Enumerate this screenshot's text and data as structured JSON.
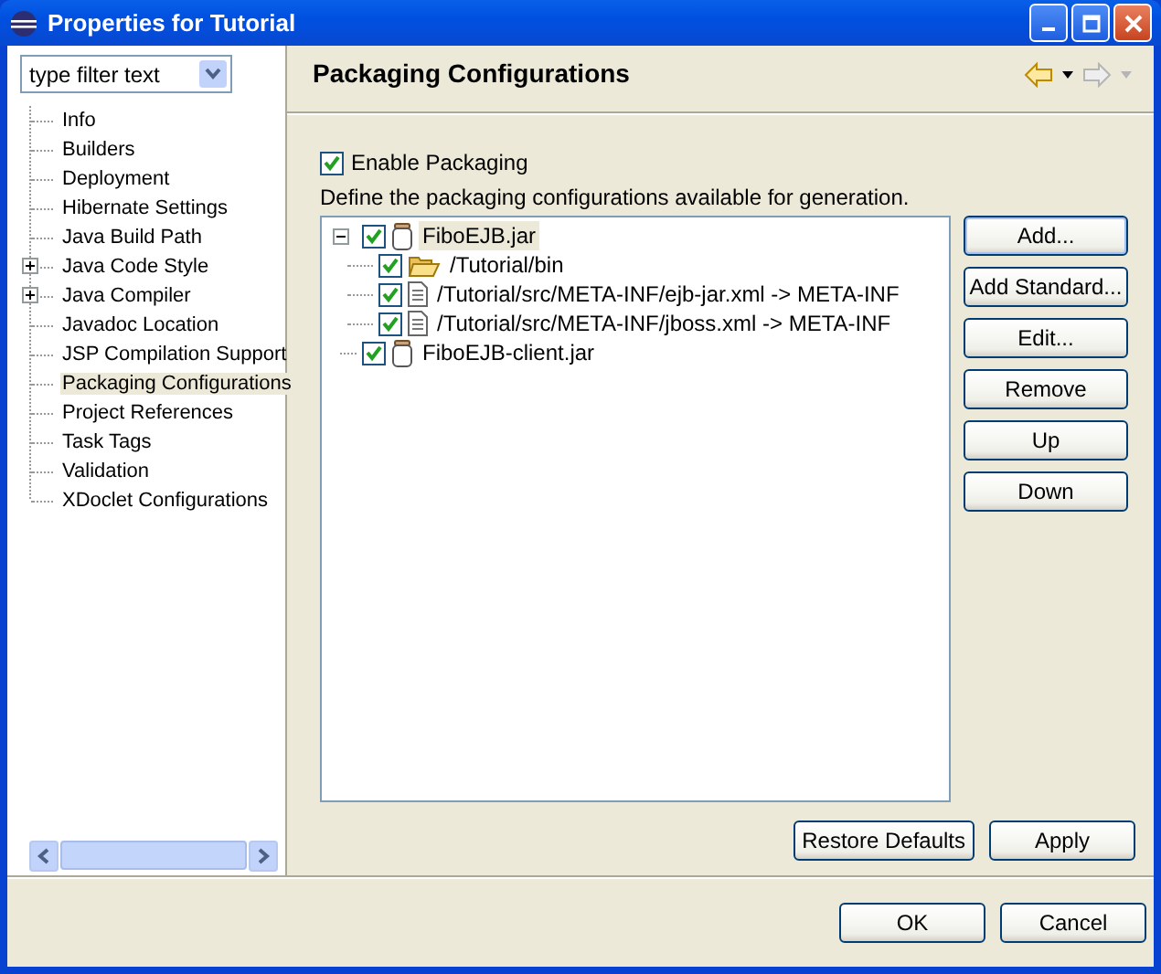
{
  "window": {
    "title": "Properties for Tutorial"
  },
  "filter": {
    "placeholder": "type filter text"
  },
  "sidebar": {
    "items": [
      {
        "label": "Info",
        "selected": false
      },
      {
        "label": "Builders",
        "selected": false
      },
      {
        "label": "Deployment",
        "selected": false
      },
      {
        "label": "Hibernate Settings",
        "selected": false
      },
      {
        "label": "Java Build Path",
        "selected": false
      },
      {
        "label": "Java Code Style",
        "selected": false,
        "expanded": false
      },
      {
        "label": "Java Compiler",
        "selected": false,
        "expanded": false
      },
      {
        "label": "Javadoc Location",
        "selected": false
      },
      {
        "label": "JSP Compilation Support",
        "selected": false
      },
      {
        "label": "Packaging Configurations",
        "selected": true
      },
      {
        "label": "Project References",
        "selected": false
      },
      {
        "label": "Task Tags",
        "selected": false
      },
      {
        "label": "Validation",
        "selected": false
      },
      {
        "label": "XDoclet Configurations",
        "selected": false
      }
    ]
  },
  "page": {
    "title": "Packaging Configurations",
    "nav": {
      "back_disabled": false,
      "forward_disabled": true
    },
    "enable_packaging": {
      "label": "Enable Packaging",
      "checked": true
    },
    "description": "Define the packaging configurations available for generation.",
    "tree": [
      {
        "label": "FiboEJB.jar",
        "kind": "jar",
        "checked": true,
        "selected": true,
        "expanded": true,
        "children": [
          {
            "label": "/Tutorial/bin",
            "kind": "folder",
            "checked": true,
            "selected": false
          },
          {
            "label": "/Tutorial/src/META-INF/ejb-jar.xml -> META-INF",
            "kind": "file",
            "checked": true,
            "selected": false
          },
          {
            "label": "/Tutorial/src/META-INF/jboss.xml -> META-INF",
            "kind": "file",
            "checked": true,
            "selected": false
          }
        ]
      },
      {
        "label": "FiboEJB-client.jar",
        "kind": "jar",
        "checked": true,
        "selected": false
      }
    ],
    "side_buttons": [
      "Add...",
      "Add Standard...",
      "Edit...",
      "Remove",
      "Up",
      "Down"
    ],
    "page_buttons": [
      "Restore Defaults",
      "Apply"
    ]
  },
  "buttons": [
    "OK",
    "Cancel"
  ]
}
